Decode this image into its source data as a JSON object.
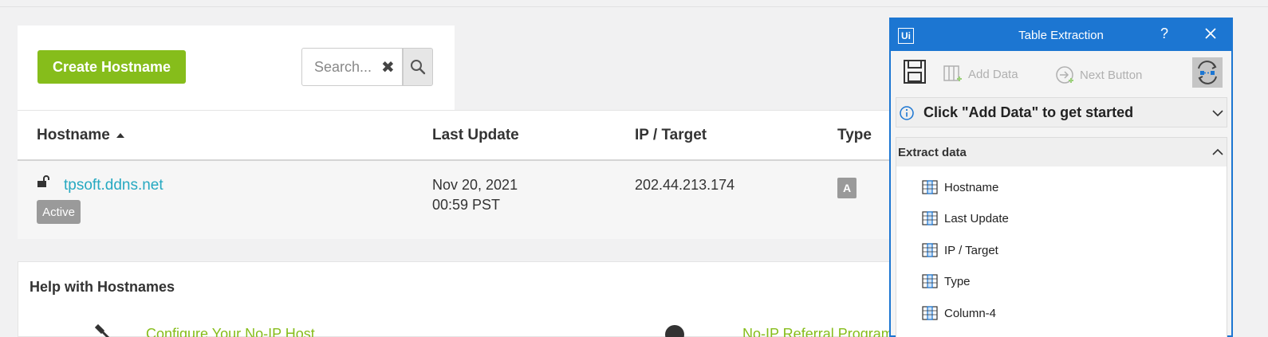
{
  "toolbar": {
    "create_label": "Create Hostname"
  },
  "search": {
    "placeholder": "Search..."
  },
  "table": {
    "headers": [
      "Hostname",
      "Last Update",
      "IP / Target",
      "Type"
    ],
    "rows": [
      {
        "hostname": "tpsoft.ddns.net",
        "status": "Active",
        "date": "Nov 20, 2021",
        "time": "00:59 PST",
        "ip": "202.44.213.174",
        "type": "A"
      }
    ]
  },
  "help": {
    "title": "Help with Hostnames",
    "link1": "Configure Your No-IP Host",
    "link2": "No-IP Referral Program"
  },
  "panel": {
    "title": "Table Extraction",
    "help": "?",
    "add_data": "Add Data",
    "next_button": "Next Button",
    "info": "Click \"Add Data\" to get started",
    "extract_title": "Extract data",
    "columns": [
      "Hostname",
      "Last Update",
      "IP / Target",
      "Type",
      "Column-4"
    ]
  },
  "colors": {
    "accent_green": "#86bd1b",
    "link_teal": "#26a9c1",
    "panel_blue": "#1c76d2"
  }
}
